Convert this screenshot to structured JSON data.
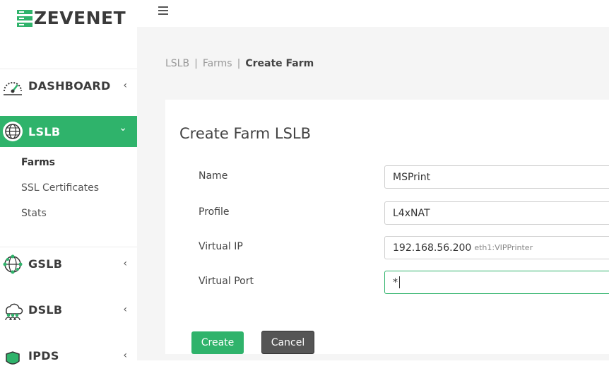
{
  "brand": {
    "name": "ZEVENET"
  },
  "sidebar": {
    "items": [
      {
        "label": "DASHBOARD",
        "icon": "gauge-icon",
        "chevron": "‹"
      },
      {
        "label": "LSLB",
        "icon": "globe-icon",
        "chevron": "⌄",
        "active": true
      },
      {
        "label": "GSLB",
        "icon": "network-globe-icon",
        "chevron": "‹"
      },
      {
        "label": "DSLB",
        "icon": "cloud-users-icon",
        "chevron": "‹"
      },
      {
        "label": "IPDS",
        "icon": "shield-icon",
        "chevron": "‹"
      }
    ],
    "lslb_sub": [
      "Farms",
      "SSL Certificates",
      "Stats"
    ]
  },
  "breadcrumb": {
    "root": "LSLB",
    "sep": "|",
    "section": "Farms",
    "current": "Create Farm"
  },
  "form": {
    "title": "Create Farm LSLB",
    "fields": [
      {
        "label": "Name",
        "value": "MSPrint"
      },
      {
        "label": "Profile",
        "value": "L4xNAT"
      },
      {
        "label": "Virtual IP",
        "value": "192.168.56.200",
        "hint": "eth1:VIPPrinter"
      },
      {
        "label": "Virtual Port",
        "value": "*"
      }
    ],
    "create_label": "Create",
    "cancel_label": "Cancel"
  },
  "colors": {
    "accent": "#2fb36b",
    "cancel": "#555555"
  }
}
